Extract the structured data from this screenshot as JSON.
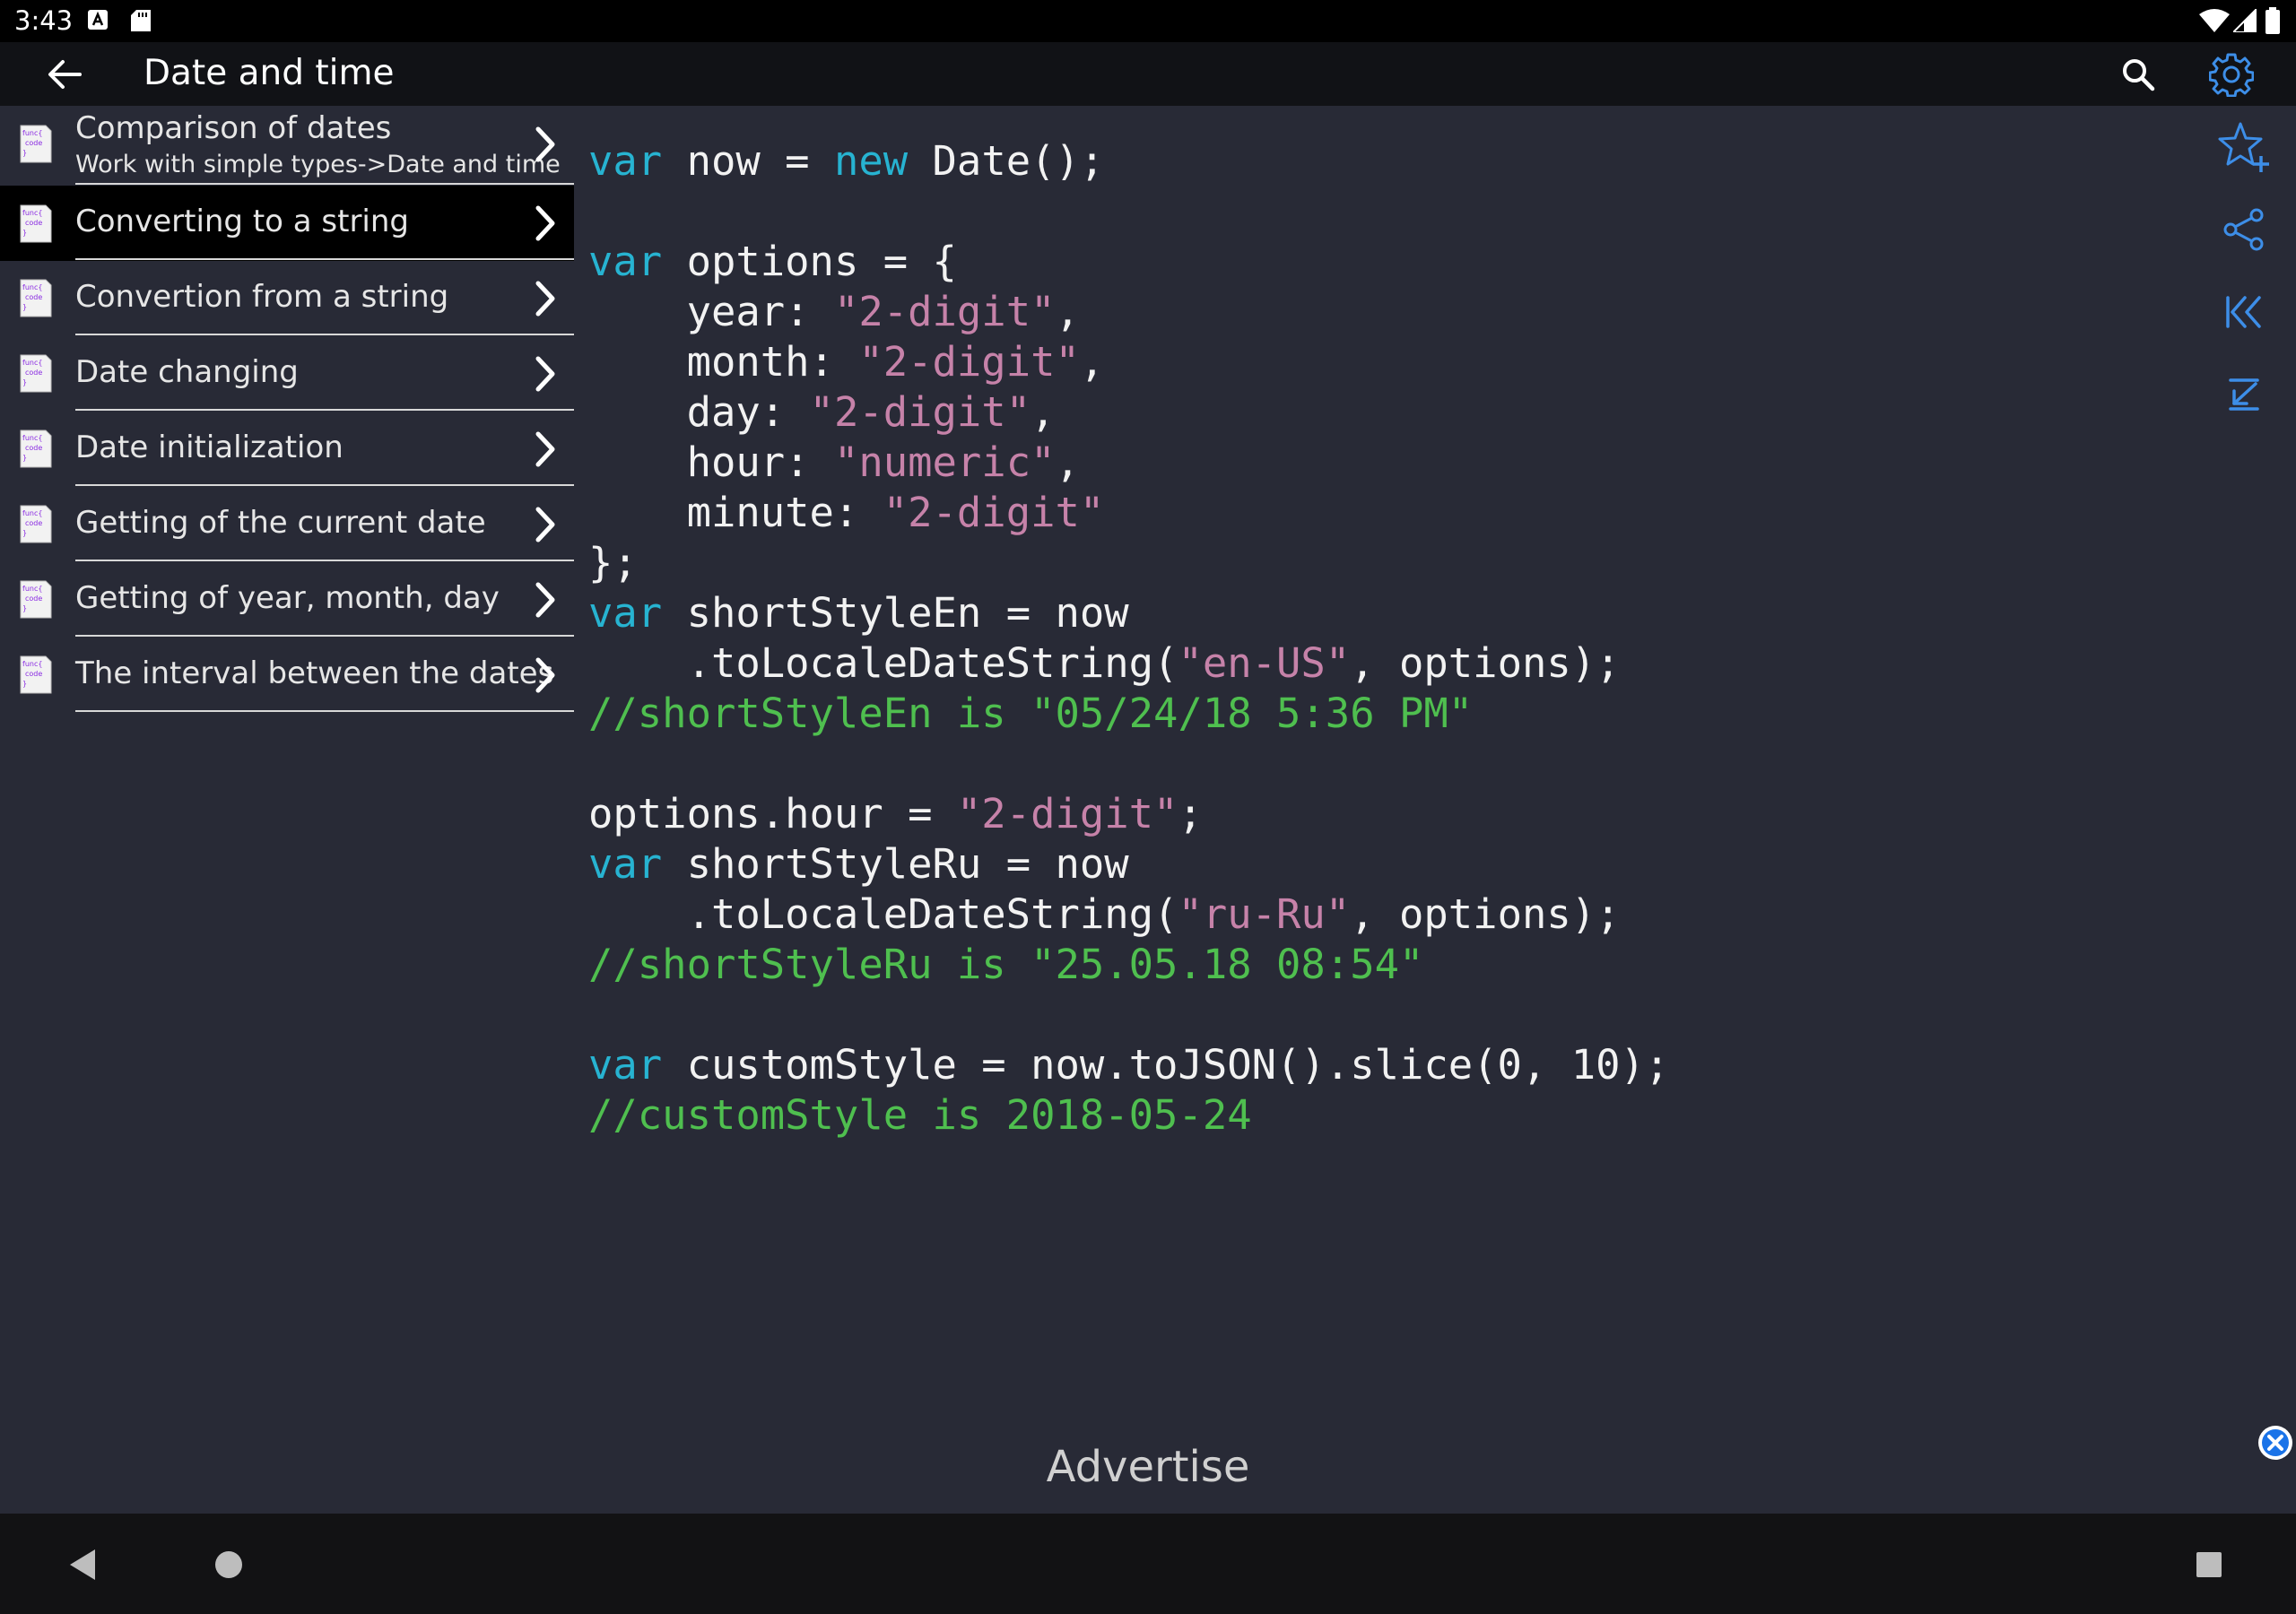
{
  "status_bar": {
    "time": "3:43"
  },
  "toolbar": {
    "title": "Date and time"
  },
  "sidebar": {
    "items": [
      {
        "label": "Comparison of dates",
        "sub": "Work with simple types->Date and time"
      },
      {
        "label": "Converting to a string",
        "active": true
      },
      {
        "label": "Convertion from a string"
      },
      {
        "label": "Date changing"
      },
      {
        "label": "Date initialization"
      },
      {
        "label": "Getting of the current date"
      },
      {
        "label": "Getting of year, month, day"
      },
      {
        "label": "The interval between the dates"
      }
    ]
  },
  "code": {
    "lines": [
      "var now = new Date();",
      "",
      "var options = {",
      "    year: \"2-digit\",",
      "    month: \"2-digit\",",
      "    day: \"2-digit\",",
      "    hour: \"numeric\",",
      "    minute: \"2-digit\"",
      "};",
      "var shortStyleEn = now",
      "    .toLocaleDateString(\"en-US\", options);",
      "//shortStyleEn is \"05/24/18 5:36 PM\"",
      "",
      "options.hour = \"2-digit\";",
      "var shortStyleRu = now",
      "    .toLocaleDateString(\"ru-Ru\", options);",
      "//shortStyleRu is \"25.05.18 08:54\"",
      "",
      "var customStyle = now.toJSON().slice(0, 10);",
      "//customStyle is 2018-05-24"
    ],
    "keywords": [
      "var",
      "new"
    ]
  },
  "ad": {
    "label": "Advertise"
  },
  "icons": {
    "back": "arrow-left-icon",
    "search": "search-icon",
    "settings": "gear-icon",
    "favorite": "star-plus-icon",
    "share": "share-icon",
    "first": "skip-to-first-icon",
    "scroll_bottom": "scroll-to-bottom-icon",
    "close": "close-icon"
  },
  "colors": {
    "background": "#282a36",
    "toolbar": "#111216",
    "keyword": "#27b3d1",
    "string": "#c682a9",
    "comment": "#4fbf4f",
    "accent": "#3d8ee8"
  }
}
